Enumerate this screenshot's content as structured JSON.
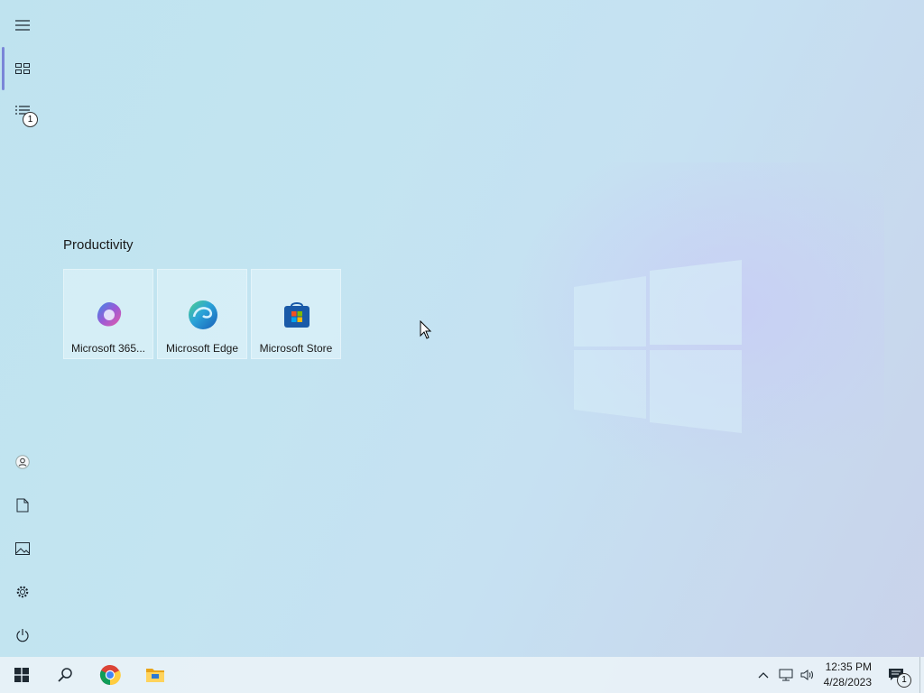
{
  "desktop": {
    "group_title": "Productivity",
    "tiles": [
      {
        "label": "Microsoft 365...",
        "icon": "microsoft-365-icon"
      },
      {
        "label": "Microsoft Edge",
        "icon": "edge-icon"
      },
      {
        "label": "Microsoft Store",
        "icon": "store-icon"
      }
    ]
  },
  "rail": {
    "items": [
      {
        "name": "expand-menu",
        "icon": "hamburger-icon"
      },
      {
        "name": "pinned-tiles",
        "icon": "tiles-icon",
        "active": true
      },
      {
        "name": "all-apps",
        "icon": "list-icon",
        "badge": "1"
      },
      {
        "name": "user",
        "icon": "user-icon"
      },
      {
        "name": "documents",
        "icon": "document-icon"
      },
      {
        "name": "pictures",
        "icon": "picture-icon"
      },
      {
        "name": "settings",
        "icon": "gear-icon"
      },
      {
        "name": "power",
        "icon": "power-icon"
      }
    ]
  },
  "taskbar": {
    "items": [
      "start-icon",
      "search-icon",
      "chrome-icon",
      "file-explorer-icon"
    ],
    "tray": {
      "time": "12:35 PM",
      "date": "4/28/2023",
      "notification_badge": "1"
    }
  },
  "colors": {
    "accent": "#7a86d8",
    "edge_blue": "#1e7fd0",
    "store_blue": "#1a5aa8"
  }
}
